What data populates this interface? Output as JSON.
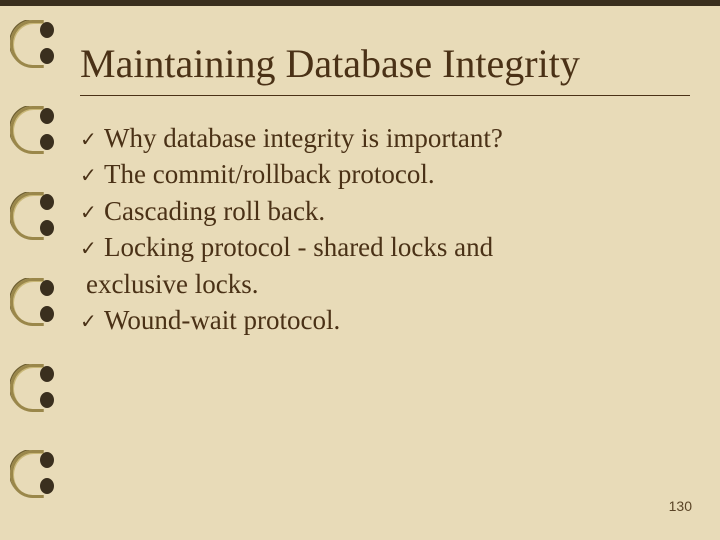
{
  "title": "Maintaining Database Integrity",
  "bullets": [
    {
      "text": "Why database integrity is important?",
      "cont": ""
    },
    {
      "text": "The commit/rollback protocol.",
      "cont": ""
    },
    {
      "text": "Cascading roll back.",
      "cont": ""
    },
    {
      "text": "Locking protocol - shared locks and",
      "cont": "exclusive locks."
    },
    {
      "text": "Wound-wait protocol.",
      "cont": ""
    }
  ],
  "page_number": "130",
  "bullet_glyph": "✓"
}
